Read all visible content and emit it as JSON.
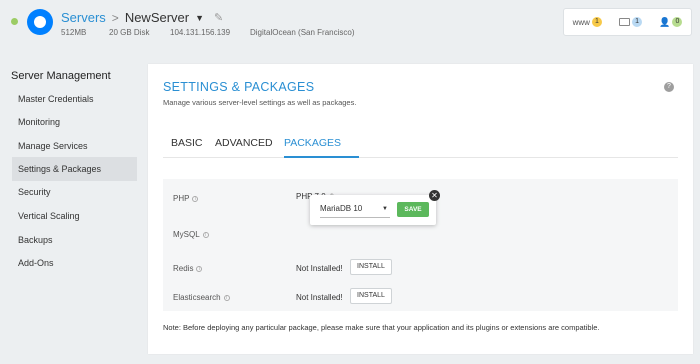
{
  "header": {
    "breadcrumb_link": "Servers",
    "breadcrumb_sep": ">",
    "server_name": "NewServer",
    "caret": "▼",
    "edit_glyph": "✎",
    "specs": {
      "ram": "512MB",
      "disk": "20 GB Disk",
      "ip": "104.131.156.139",
      "provider": "DigitalOcean (San Francisco)"
    },
    "counters": [
      {
        "label": "www",
        "count": "1",
        "icon": "www-icon"
      },
      {
        "label": "",
        "count": "1",
        "icon": "folder-icon"
      },
      {
        "label": "",
        "count": "0",
        "icon": "users-icon"
      }
    ]
  },
  "sidebar": {
    "title": "Server Management",
    "items": [
      {
        "label": "Master Credentials"
      },
      {
        "label": "Monitoring"
      },
      {
        "label": "Manage Services"
      },
      {
        "label": "Settings & Packages",
        "active": true
      },
      {
        "label": "Security"
      },
      {
        "label": "Vertical Scaling"
      },
      {
        "label": "Backups"
      },
      {
        "label": "Add-Ons"
      }
    ]
  },
  "main": {
    "title": "SETTINGS & PACKAGES",
    "subtitle": "Manage various server-level settings as well as packages.",
    "help": "?",
    "tabs": [
      {
        "label": "BASIC"
      },
      {
        "label": "ADVANCED"
      },
      {
        "label": "PACKAGES",
        "active": true
      }
    ],
    "packages": {
      "php": {
        "label": "PHP",
        "value": "PHP 7.0"
      },
      "mysql": {
        "label": "MySQL",
        "select_value": "MariaDB 10",
        "save_label": "SAVE",
        "close": "✕"
      },
      "redis": {
        "label": "Redis",
        "status": "Not Installed!",
        "button": "INSTALL"
      },
      "elasticsearch": {
        "label": "Elasticsearch",
        "status": "Not Installed!",
        "button": "INSTALL"
      }
    },
    "note": "Note: Before deploying any particular package, please make sure that your application and its plugins or extensions are compatible."
  },
  "colors": {
    "accent": "#2a8fd3",
    "save": "#5cb85c",
    "status_online": "#9ccc65"
  }
}
